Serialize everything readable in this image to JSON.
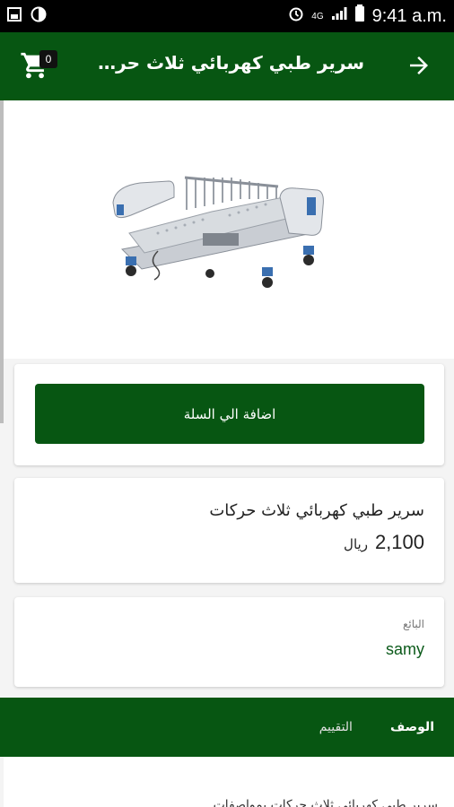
{
  "status_bar": {
    "network": "4G",
    "time": "9:41 a.m."
  },
  "app_bar": {
    "title": "سرير طبي كهربائي ثلاث حركات",
    "cart_count": "0"
  },
  "actions": {
    "add_to_cart_label": "اضافة الي السلة"
  },
  "product": {
    "name": "سرير طبي كهربائي ثلاث حركات",
    "price": "2,100",
    "currency": "ريال"
  },
  "seller": {
    "label": "البائع",
    "name": "samy"
  },
  "tabs": [
    {
      "label": "الوصف",
      "active": true
    },
    {
      "label": "التقييم",
      "active": false
    }
  ],
  "description": {
    "text": "سرير طبي كهربائي ثلاث حركات بمواصفات"
  },
  "colors": {
    "primary": "#075612",
    "status_bar": "#000000"
  },
  "icons": {
    "back": "arrow-right-icon",
    "cart": "cart-icon"
  }
}
